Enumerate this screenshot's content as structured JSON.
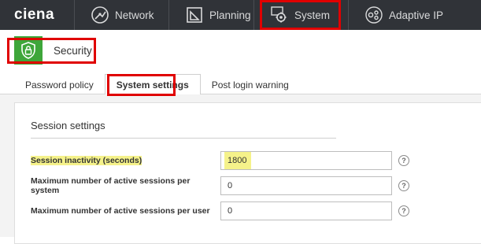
{
  "topnav": {
    "logo": "ciena",
    "items": [
      {
        "label": "Network",
        "icon": "network-icon"
      },
      {
        "label": "Planning",
        "icon": "planning-icon"
      },
      {
        "label": "System",
        "icon": "gear-icon"
      },
      {
        "label": "Adaptive IP",
        "icon": "adaptive-ip-icon"
      }
    ]
  },
  "header": {
    "title": "Security",
    "icon": "shield-lock-icon",
    "icon_bg": "#3ea63a"
  },
  "tabs": [
    {
      "label": "Password policy",
      "active": false
    },
    {
      "label": "System settings",
      "active": true
    },
    {
      "label": "Post login warning",
      "active": false
    }
  ],
  "session": {
    "title": "Session settings",
    "rows": [
      {
        "label": "Session inactivity (seconds)",
        "value": "1800",
        "help": "?"
      },
      {
        "label": "Maximum number of active sessions per system",
        "value": "0",
        "help": "?"
      },
      {
        "label": "Maximum number of active sessions per user",
        "value": "0",
        "help": "?"
      }
    ]
  },
  "colors": {
    "topbar": "#303338",
    "highlight_box": "#e00000",
    "marker": "#f5f28a"
  }
}
